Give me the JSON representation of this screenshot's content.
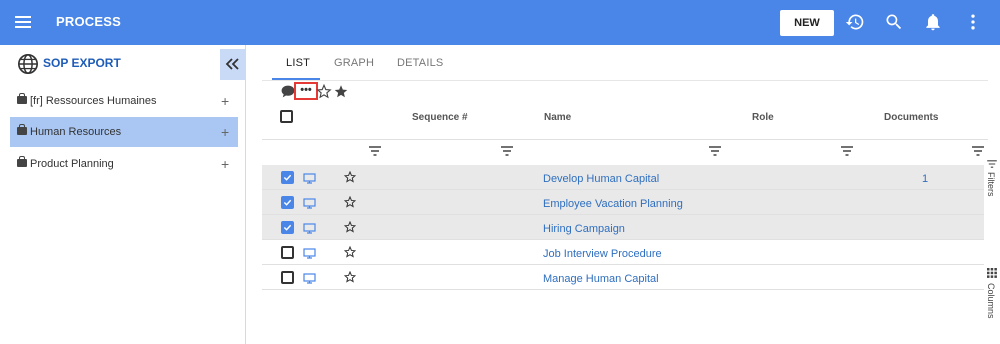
{
  "header": {
    "title": "PROCESS",
    "new_label": "NEW",
    "icons": [
      "menu-icon",
      "history-icon",
      "search-icon",
      "bell-icon",
      "more-vert-icon"
    ],
    "color": "#4a86e8"
  },
  "sidebar": {
    "title": "SOP EXPORT",
    "items": [
      {
        "label": "[fr] Ressources Humaines",
        "selected": false
      },
      {
        "label": "Human Resources",
        "selected": true
      },
      {
        "label": "Product Planning",
        "selected": false
      }
    ]
  },
  "tabs": [
    {
      "label": "LIST",
      "active": true
    },
    {
      "label": "GRAPH",
      "active": false
    },
    {
      "label": "DETAILS",
      "active": false
    }
  ],
  "toolbar": {
    "dots": "•••"
  },
  "table": {
    "columns": [
      "Sequence #",
      "Name",
      "Role",
      "Documents"
    ],
    "rows": [
      {
        "checked": true,
        "name": "Develop Human Capital",
        "documents": "1"
      },
      {
        "checked": true,
        "name": "Employee Vacation Planning",
        "documents": ""
      },
      {
        "checked": true,
        "name": "Hiring Campaign",
        "documents": ""
      },
      {
        "checked": false,
        "name": "Job Interview Procedure",
        "documents": ""
      },
      {
        "checked": false,
        "name": "Manage Human Capital",
        "documents": ""
      }
    ]
  },
  "right_rail": {
    "filters_label": "Filters",
    "columns_label": "Columns"
  }
}
